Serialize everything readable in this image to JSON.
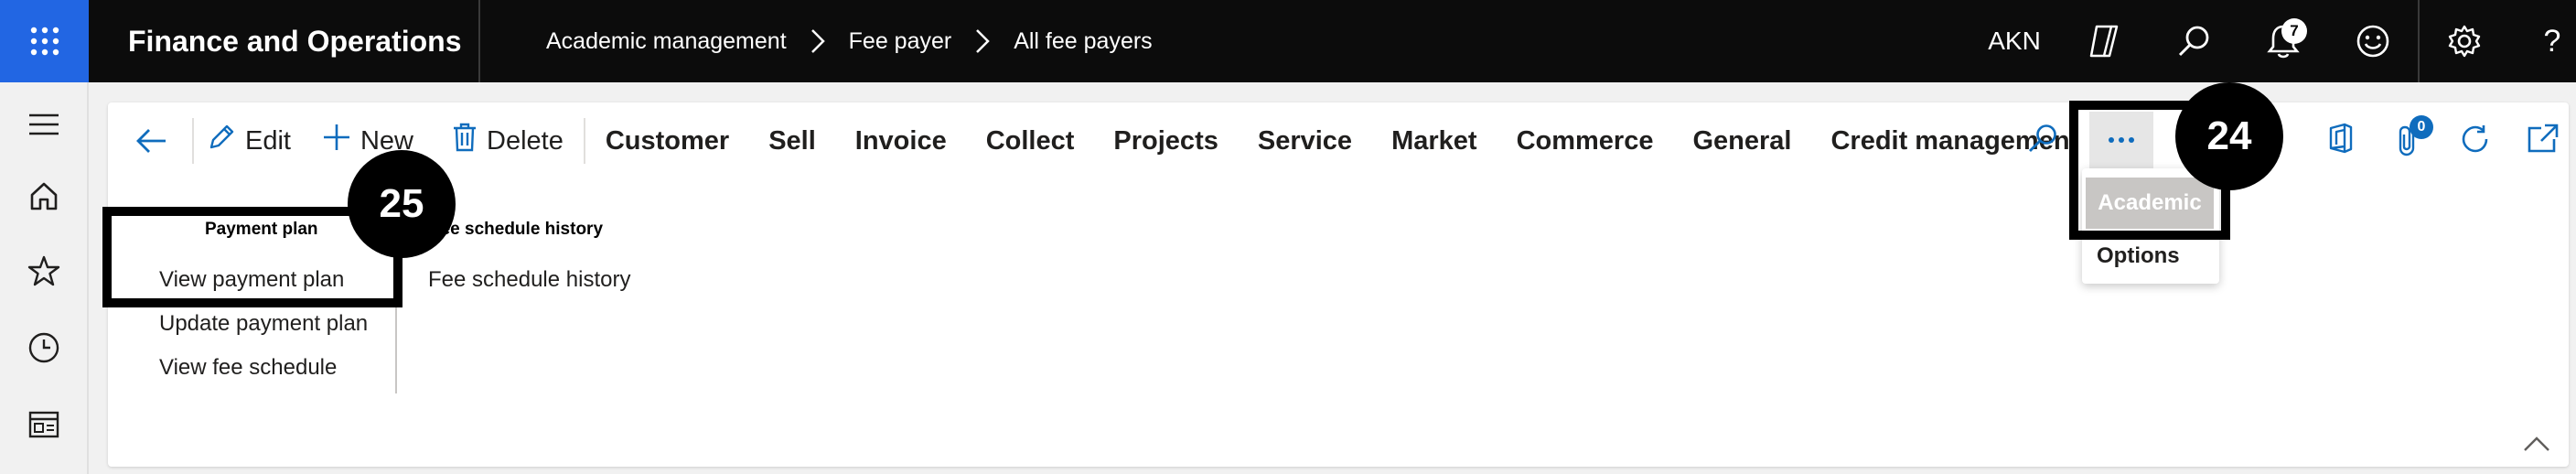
{
  "topbar": {
    "app_title": "Finance and Operations",
    "breadcrumb": [
      "Academic management",
      "Fee payer",
      "All fee payers"
    ],
    "user_code": "AKN",
    "notification_count": "7"
  },
  "actionbar": {
    "edit": "Edit",
    "new": "New",
    "delete": "Delete",
    "tabs": [
      "Customer",
      "Sell",
      "Invoice",
      "Collect",
      "Projects",
      "Service",
      "Market",
      "Commerce",
      "General",
      "Credit management"
    ],
    "more_label": "...",
    "attachment_count": "0"
  },
  "groups": {
    "payment_plan": {
      "title": "Payment plan",
      "items": [
        "View payment plan",
        "Update payment plan",
        "View fee schedule"
      ]
    },
    "fee_schedule_history": {
      "title": "Fee schedule history",
      "items": [
        "Fee schedule history"
      ]
    }
  },
  "dropdown": {
    "items": [
      "Academic",
      "Options"
    ],
    "selected": "Academic"
  },
  "annotations": {
    "step_a": "25",
    "step_b": "24"
  },
  "icons": [
    "waffle-icon",
    "copilot-icon",
    "search-icon",
    "bell-icon",
    "smiley-icon",
    "gear-icon",
    "help-icon",
    "hamburger-icon",
    "home-icon",
    "star-icon",
    "clock-icon",
    "workspace-icon",
    "back-arrow-icon",
    "pencil-icon",
    "plus-icon",
    "trash-icon",
    "office-icon",
    "attachment-icon",
    "refresh-icon",
    "open-new-icon",
    "chevron-up-icon"
  ],
  "colors": {
    "accent": "#2266e3",
    "topbar": "#0c0c0c",
    "link_blue": "#0f6cbd"
  }
}
